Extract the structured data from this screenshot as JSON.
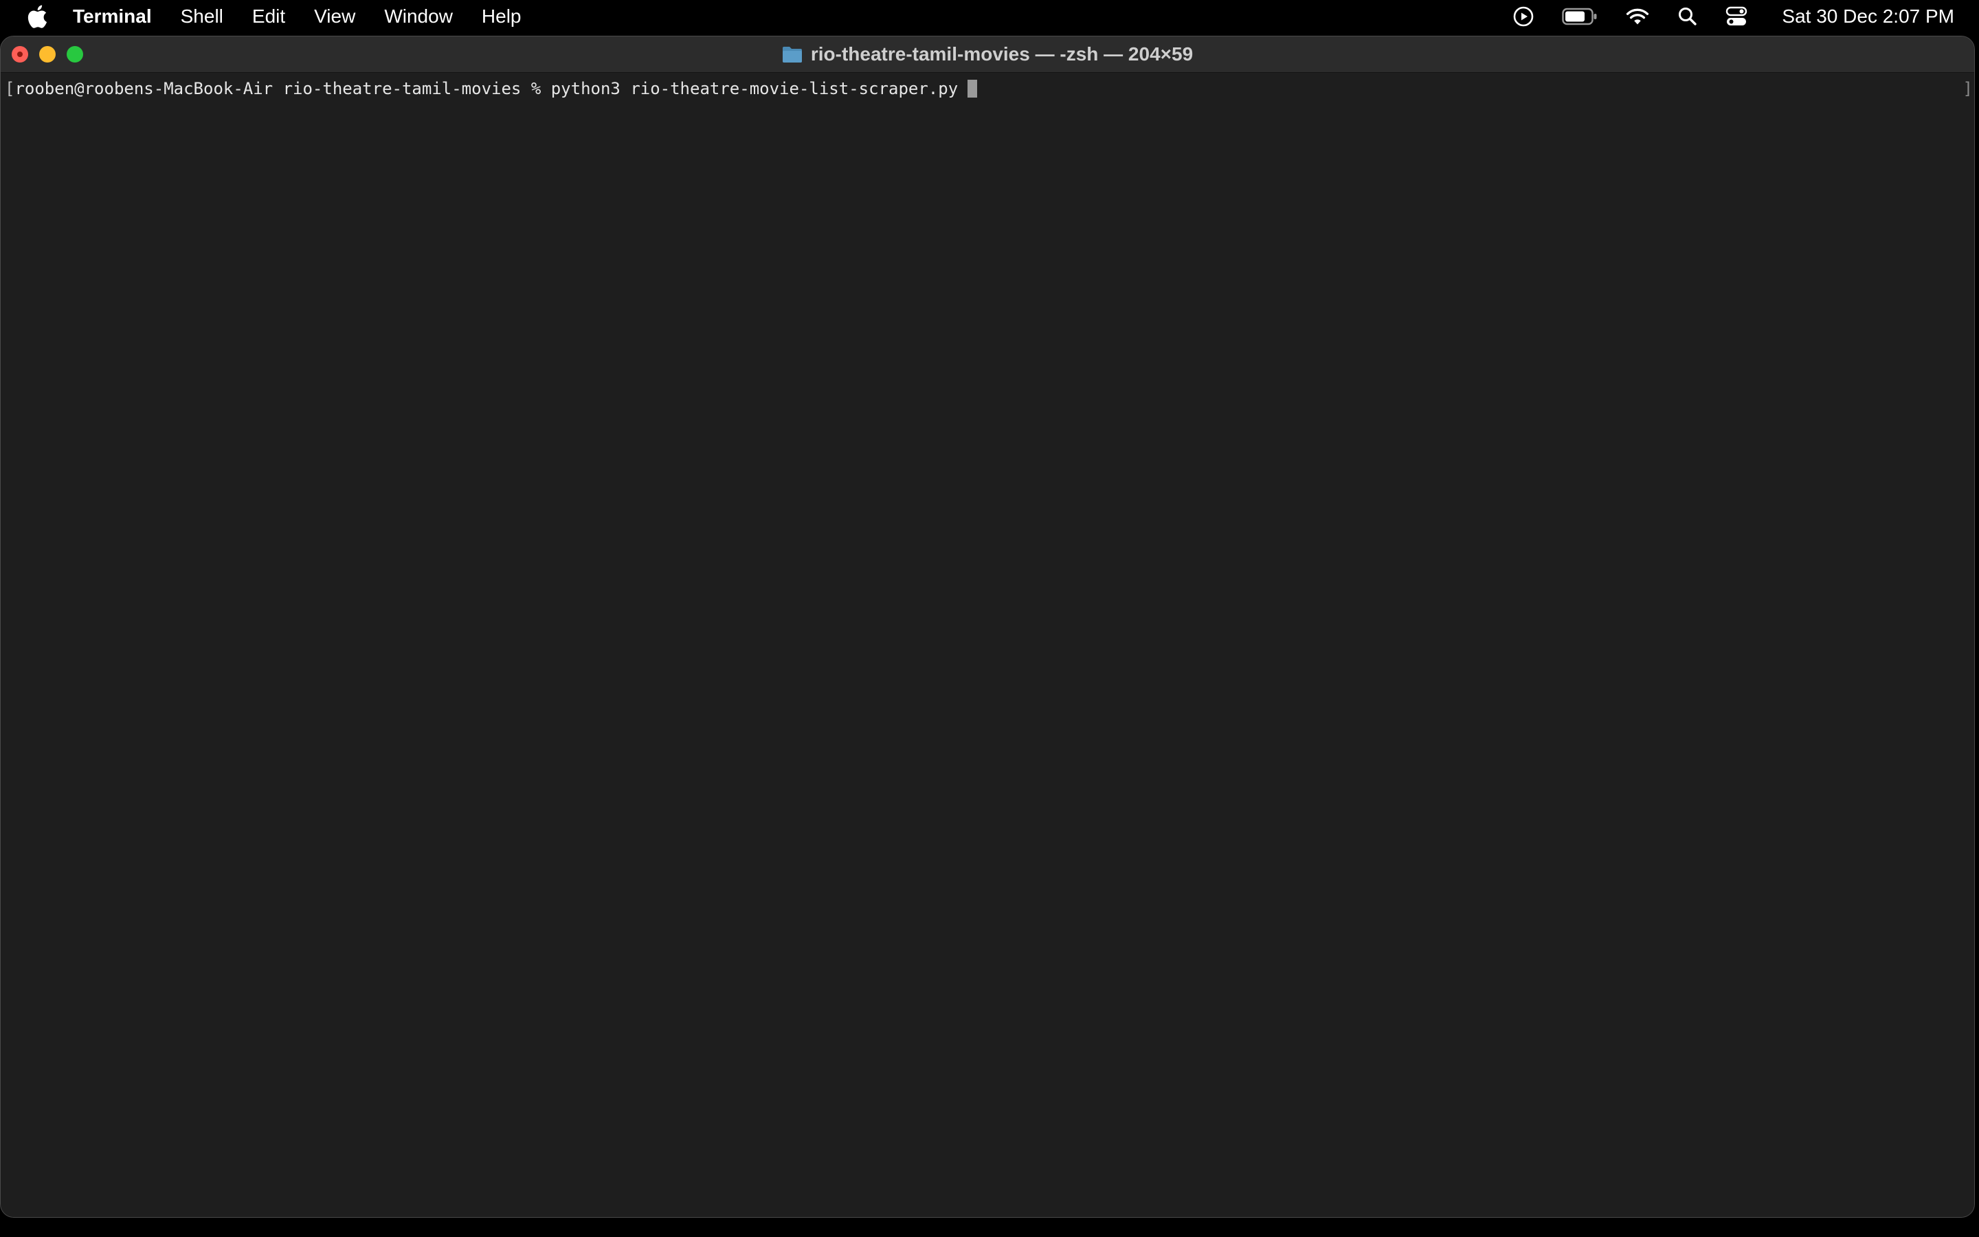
{
  "menubar": {
    "app_name": "Terminal",
    "items": [
      {
        "label": "Shell"
      },
      {
        "label": "Edit"
      },
      {
        "label": "View"
      },
      {
        "label": "Window"
      },
      {
        "label": "Help"
      }
    ],
    "status_icons": [
      "play-circle-icon",
      "battery-icon",
      "wifi-icon",
      "search-icon",
      "control-center-icon"
    ],
    "clock": "Sat 30 Dec  2:07 PM"
  },
  "window": {
    "title": "rio-theatre-tamil-movies — -zsh — 204×59",
    "title_icon": "folder-icon"
  },
  "terminal": {
    "prompt_open": "[",
    "prompt": "rooben@roobens-MacBook-Air rio-theatre-tamil-movies % ",
    "command": "python3 rio-theatre-movie-list-scraper.py",
    "right_edge": "]"
  },
  "colors": {
    "close": "#ff5f57",
    "minimize": "#febc2e",
    "zoom": "#28c840",
    "terminal_bg": "#1e1e1e",
    "folder": "#4a8ab5"
  }
}
